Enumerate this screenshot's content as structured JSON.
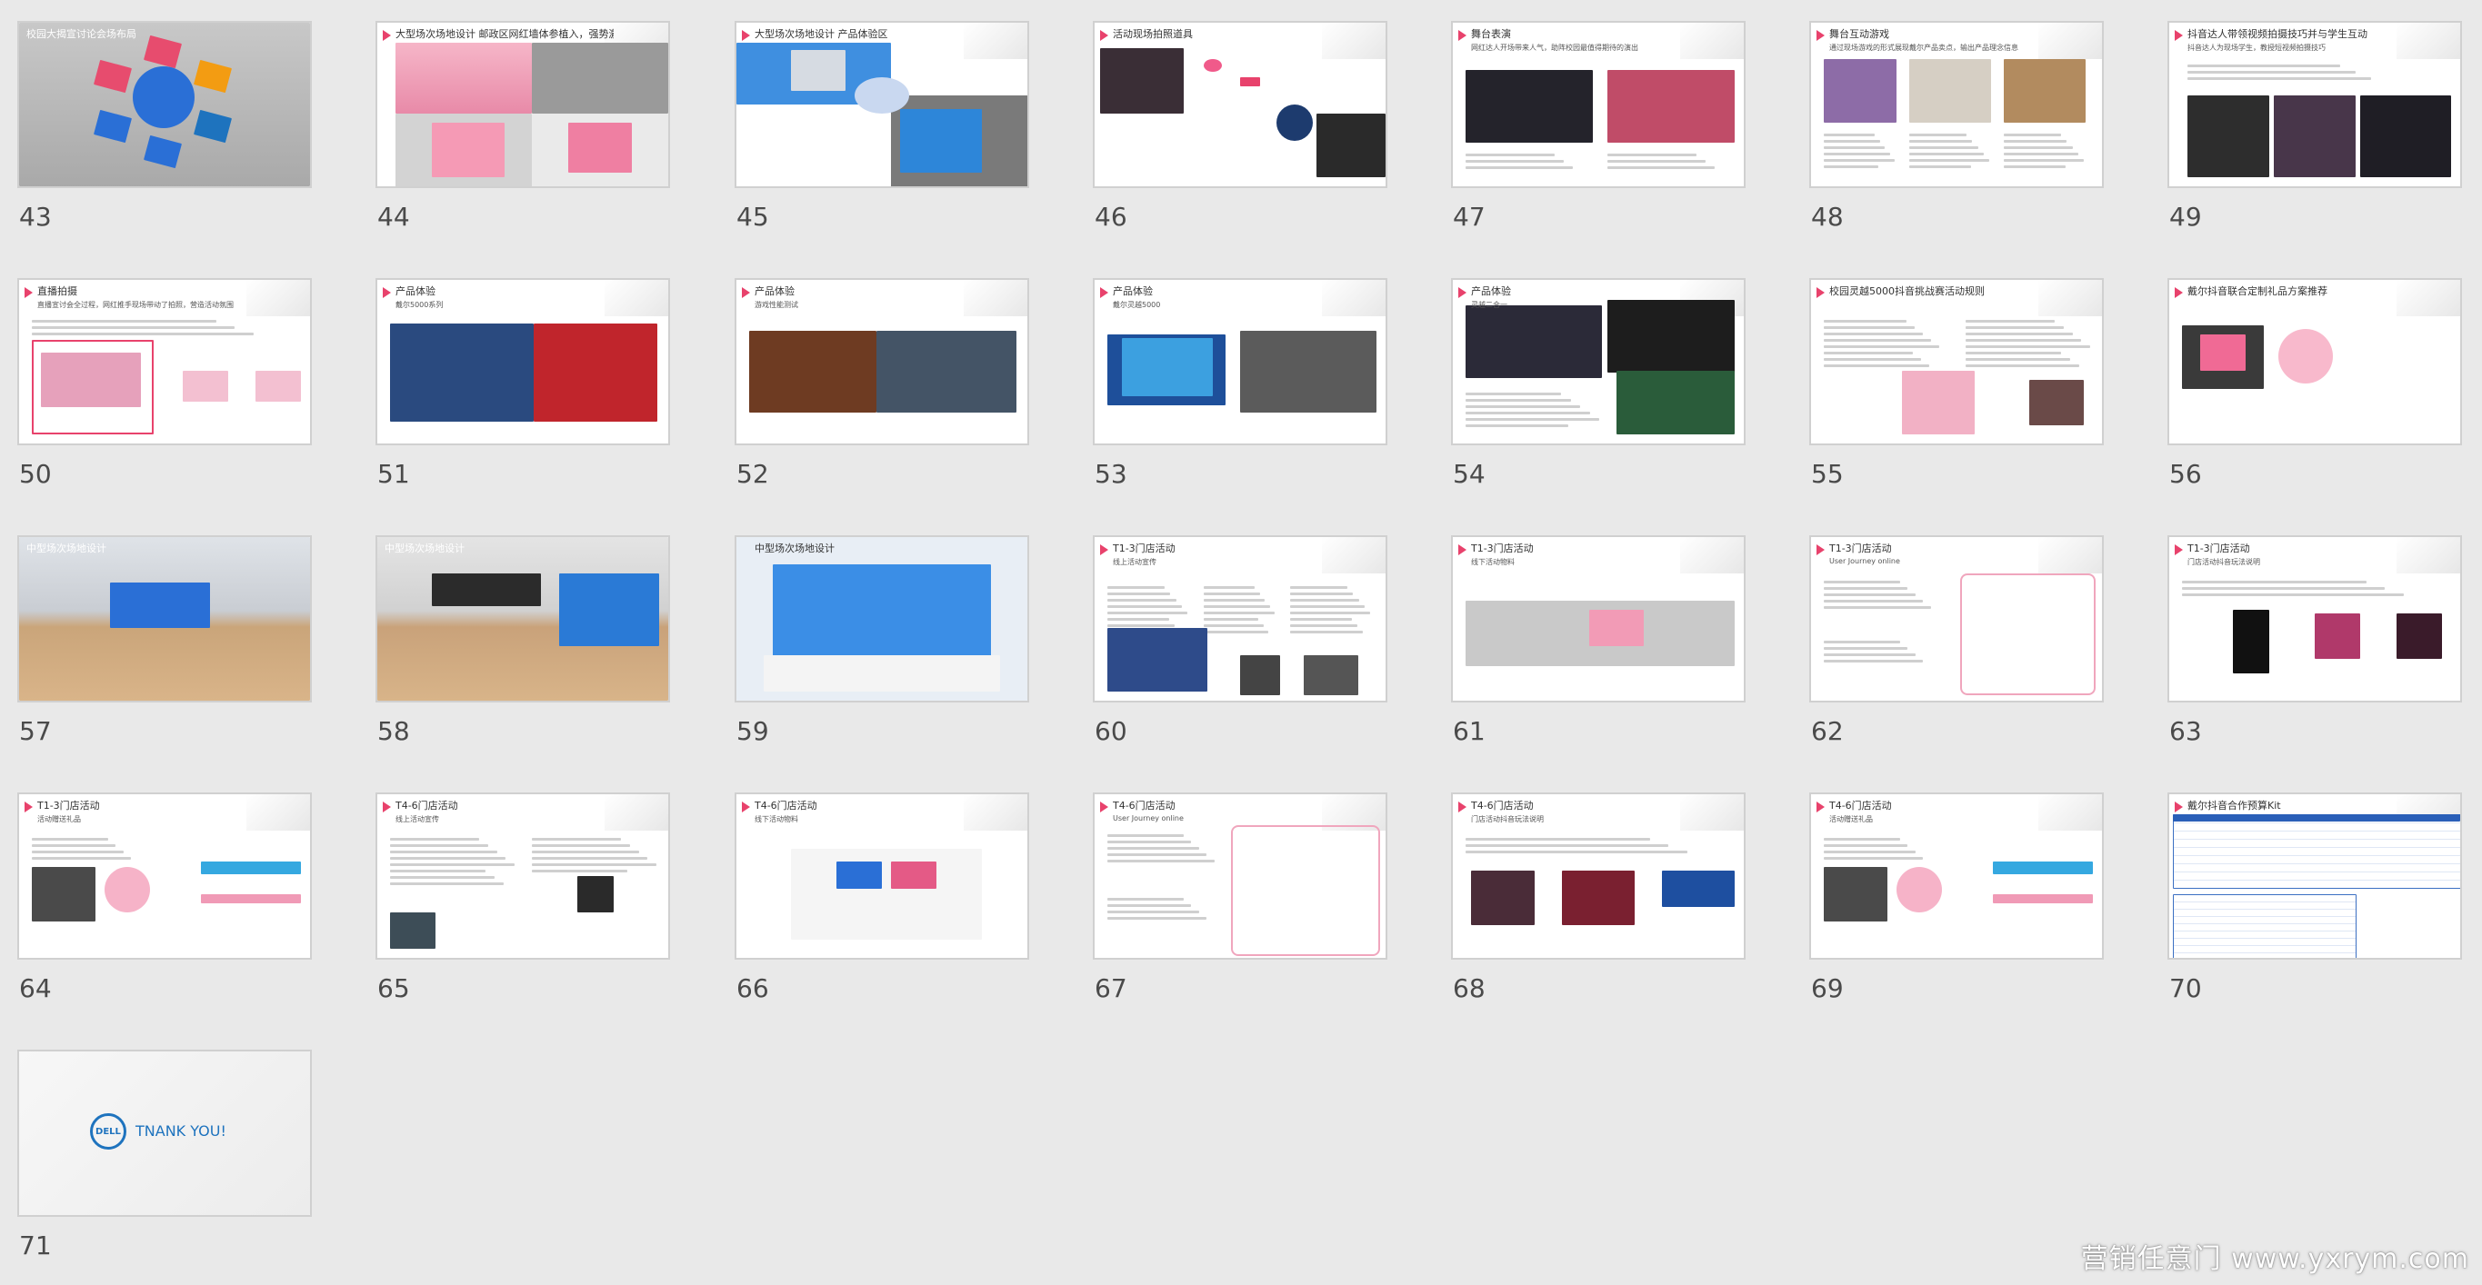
{
  "view": "slide-sorter",
  "colors": {
    "accent": "#e8426c",
    "background": "#e9e9e9",
    "brand_blue": "#1e73be"
  },
  "slides": [
    {
      "num": "43",
      "title": "校园大揭宣讨论会场布局",
      "sub": "",
      "thumb": "gray-center"
    },
    {
      "num": "44",
      "title": "大型场次场地设计  邮政区网红墙体参植入，强势激发用户拍照打卡热情",
      "sub": "",
      "thumb": "pink-photos"
    },
    {
      "num": "45",
      "title": "大型场次场地设计    产品体验区",
      "sub": "",
      "thumb": "blue-booth"
    },
    {
      "num": "46",
      "title": "活动现场拍照道具",
      "sub": "",
      "thumb": "props"
    },
    {
      "num": "47",
      "title": "舞台表演",
      "sub": "网红达人开场带来人气，助阵校园最值得期待的演出",
      "thumb": "stage"
    },
    {
      "num": "48",
      "title": "舞台互动游戏",
      "sub": "通过现场游戏的形式展现戴尔产品卖点，输出产品理念信息",
      "thumb": "game"
    },
    {
      "num": "49",
      "title": "抖音达人带领视频拍摄技巧并与学生互动",
      "sub": "抖音达人为现场学生，教授短视频拍摄技巧",
      "thumb": "dancers"
    },
    {
      "num": "50",
      "title": "直播拍摄",
      "sub": "直播宣讨会全过程，网红推手现场带动了拍照，营造活动氛围",
      "thumb": "livestream"
    },
    {
      "num": "51",
      "title": "产品体验",
      "sub": "戴尔5000系列",
      "thumb": "coco"
    },
    {
      "num": "52",
      "title": "产品体验",
      "sub": "游戏性能测试",
      "thumb": "games"
    },
    {
      "num": "53",
      "title": "产品体验",
      "sub": "戴尔灵越5000",
      "thumb": "laptops"
    },
    {
      "num": "54",
      "title": "产品体验",
      "sub": "灵越二合一",
      "thumb": "convertible"
    },
    {
      "num": "55",
      "title": "校园灵越5000抖音挑战赛活动规则",
      "sub": "",
      "thumb": "rules"
    },
    {
      "num": "56",
      "title": "戴尔抖音联合定制礼品方案推荐",
      "sub": "",
      "thumb": "gift"
    },
    {
      "num": "57",
      "title": "中型场次场地设计",
      "sub": "",
      "thumb": "hall"
    },
    {
      "num": "58",
      "title": "中型场次场地设计",
      "sub": "",
      "thumb": "hall2"
    },
    {
      "num": "59",
      "title": "中型场次场地设计",
      "sub": "",
      "thumb": "hall3"
    },
    {
      "num": "60",
      "title": "T1-3门店活动",
      "sub": "线上活动宣传",
      "thumb": "store"
    },
    {
      "num": "61",
      "title": "T1-3门店活动",
      "sub": "线下活动物料",
      "thumb": "store2"
    },
    {
      "num": "62",
      "title": "T1-3门店活动",
      "sub": "User Journey online",
      "thumb": "journey"
    },
    {
      "num": "63",
      "title": "T1-3门店活动",
      "sub": "门店活动抖音玩法说明",
      "thumb": "phones"
    },
    {
      "num": "64",
      "title": "T1-3门店活动",
      "sub": "活动赠送礼品",
      "thumb": "gift2"
    },
    {
      "num": "65",
      "title": "T4-6门店活动",
      "sub": "线上活动宣传",
      "thumb": "text-doc"
    },
    {
      "num": "66",
      "title": "T4-6门店活动",
      "sub": "线下活动物料",
      "thumb": "counter"
    },
    {
      "num": "67",
      "title": "T4-6门店活动",
      "sub": "User Journey online",
      "thumb": "journey2"
    },
    {
      "num": "68",
      "title": "T4-6门店活动",
      "sub": "门店活动抖音玩法说明",
      "thumb": "phones2"
    },
    {
      "num": "69",
      "title": "T4-6门店活动",
      "sub": "活动赠送礼品",
      "thumb": "gift3"
    },
    {
      "num": "70",
      "title": "戴尔抖音合作预算Kit",
      "sub": "",
      "thumb": "table"
    },
    {
      "num": "71",
      "title": "",
      "sub": "",
      "thumb": "thanks"
    }
  ],
  "thanks": {
    "logo_text": "DELL",
    "text": "TNANK YOU!"
  },
  "watermark": "营销任意门  www.yxrym.com"
}
